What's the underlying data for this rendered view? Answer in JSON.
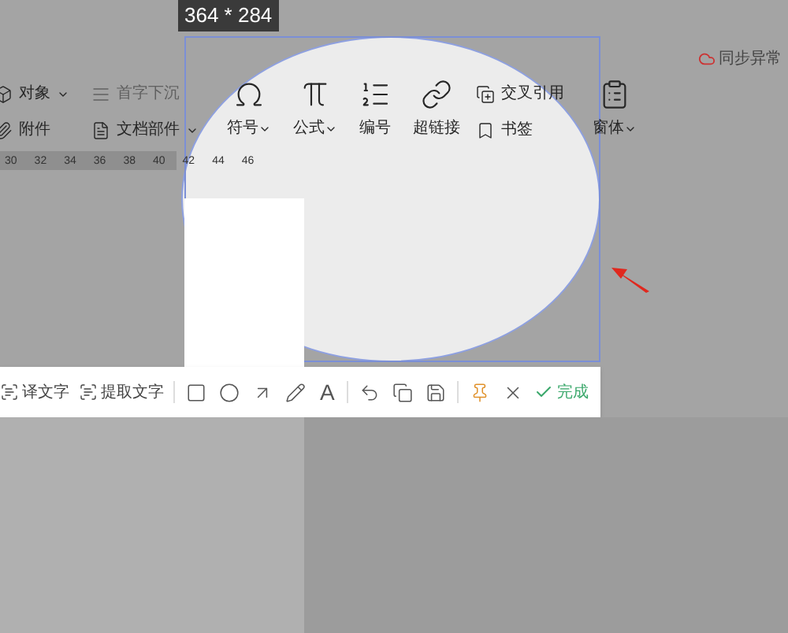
{
  "selection": {
    "size": "364 * 284"
  },
  "ribbon": {
    "columns": [
      {
        "large": false,
        "items": [
          {
            "kind": "object",
            "label": "对象",
            "dropdown": true,
            "disabled": false
          },
          {
            "kind": "attach",
            "label": "附件",
            "dropdown": false,
            "disabled": false
          }
        ]
      },
      {
        "large": false,
        "items": [
          {
            "kind": "dropcap",
            "label": "首字下沉",
            "dropdown": false,
            "disabled": true
          },
          {
            "kind": "docpart",
            "label": "文档部件",
            "dropdown": true,
            "disabled": false
          }
        ]
      },
      {
        "large": true,
        "items": [
          {
            "kind": "symbol",
            "label": "符号",
            "dropdown": true,
            "disabled": false
          }
        ]
      },
      {
        "large": true,
        "items": [
          {
            "kind": "formula",
            "label": "公式",
            "dropdown": true,
            "disabled": false
          }
        ]
      },
      {
        "large": true,
        "items": [
          {
            "kind": "number",
            "label": "编号",
            "dropdown": false,
            "disabled": false
          }
        ]
      },
      {
        "large": true,
        "items": [
          {
            "kind": "link",
            "label": "超链接",
            "dropdown": false,
            "disabled": false
          }
        ]
      },
      {
        "large": false,
        "items": [
          {
            "kind": "crossref",
            "label": "交叉引用",
            "dropdown": false,
            "disabled": false
          },
          {
            "kind": "bookmark",
            "label": "书签",
            "dropdown": false,
            "disabled": false
          }
        ]
      },
      {
        "large": true,
        "items": [
          {
            "kind": "form",
            "label": "窗体",
            "dropdown": true,
            "disabled": false
          }
        ]
      }
    ]
  },
  "sync_status": "同步异常",
  "ruler": [
    "30",
    "32",
    "34",
    "36",
    "38",
    "40",
    "42",
    "44",
    "46"
  ],
  "capture_toolbar": [
    {
      "kind": "translate",
      "label": "译文字"
    },
    {
      "kind": "extract",
      "label": "提取文字"
    },
    {
      "kind": "separator"
    },
    {
      "kind": "rect"
    },
    {
      "kind": "ellipse"
    },
    {
      "kind": "arrow"
    },
    {
      "kind": "pencil"
    },
    {
      "kind": "text",
      "label": "A"
    },
    {
      "kind": "separator"
    },
    {
      "kind": "undo"
    },
    {
      "kind": "copy"
    },
    {
      "kind": "save"
    },
    {
      "kind": "separator"
    },
    {
      "kind": "pin"
    },
    {
      "kind": "cancel"
    },
    {
      "kind": "done",
      "label": "完成"
    }
  ]
}
